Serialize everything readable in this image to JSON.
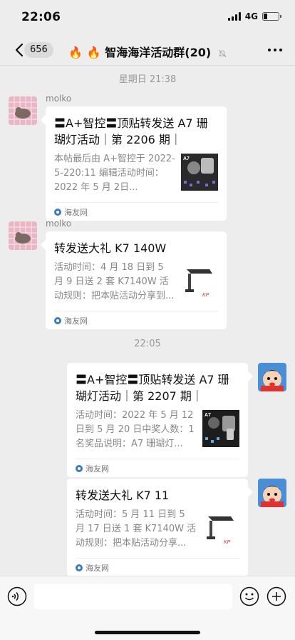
{
  "status_bar": {
    "time": "22:06",
    "network": "4G",
    "battery_percent": 25
  },
  "header": {
    "back_badge": "656",
    "title": "🔥 🔥 智海海洋活动群(20)"
  },
  "chat": {
    "timestamps": [
      "星期日 21:38",
      "22:05"
    ],
    "messages": [
      {
        "sender": "molko",
        "title": "〓A+智控〓顶贴转发送 A7 珊瑚灯活动｜第 2206 期｜",
        "desc": "本帖最后由 A+智控于 2022-5-220:11 编辑活动时间：2022 年 5 月 2日...",
        "source": "海友网",
        "thumb_icon": "a7-coral-light-thumbnail"
      },
      {
        "sender": "molko",
        "title": "转发送大礼 K7 140W",
        "desc": "活动时间：4 月 18 日到 5 月 9 日送 2 套 K7140W 活动规则：把本贴活动分享到...",
        "source": "海友网",
        "thumb_icon": "k7-lamp-thumbnail"
      },
      {
        "sender": "",
        "title": "〓A+智控〓顶贴转发送 A7 珊瑚灯活动｜第 2207 期｜",
        "desc": "活动时间：2022 年 5 月 12 日到 5 月 20 日中奖人数：1 名奖品说明：A7 珊瑚灯...",
        "source": "海友网",
        "thumb_icon": "a7-coral-light-thumbnail"
      },
      {
        "sender": "",
        "title": "转发送大礼 K7 11",
        "desc": "活动时间：5 月 11 日到 5 月 17 日送 1 套 K7140W 活动规则：把本贴活动分享...",
        "source": "海友网",
        "thumb_icon": "k7-lamp-thumbnail"
      }
    ]
  },
  "input_bar": {
    "placeholder": ""
  },
  "colors": {
    "background": "#ededed",
    "bubble": "#ffffff",
    "meta_text": "#888888"
  }
}
